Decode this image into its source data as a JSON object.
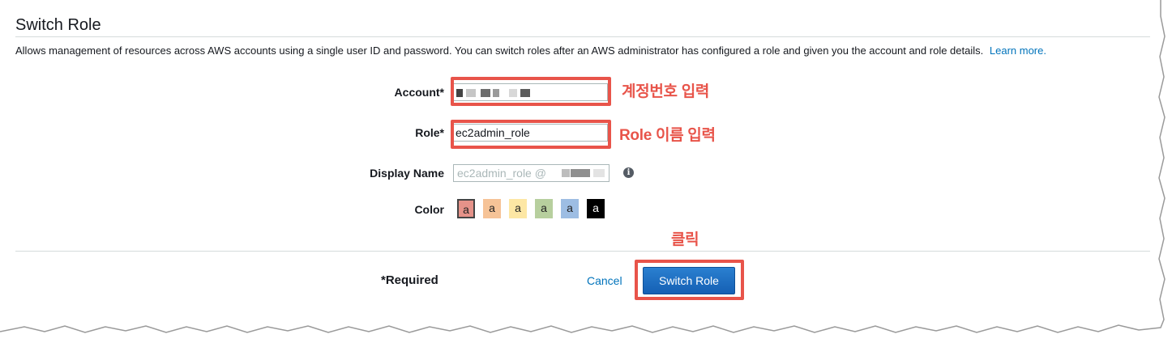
{
  "header": {
    "title": "Switch Role",
    "description": "Allows management of resources across AWS accounts using a single user ID and password. You can switch roles after an AWS administrator has configured a role and given you the account and role details.",
    "learn_more": "Learn more."
  },
  "form": {
    "account_label": "Account*",
    "account_value": "",
    "role_label": "Role*",
    "role_value": "ec2admin_role",
    "display_name_label": "Display Name",
    "display_name_placeholder": "ec2admin_role @",
    "color_label": "Color",
    "swatches": [
      {
        "letter": "a",
        "color": "#e59289",
        "selected": true
      },
      {
        "letter": "a",
        "color": "#f6c397"
      },
      {
        "letter": "a",
        "color": "#fde7a4"
      },
      {
        "letter": "a",
        "color": "#b7cf9e"
      },
      {
        "letter": "a",
        "color": "#9dbde3"
      },
      {
        "letter": "a",
        "color": "#000000"
      }
    ]
  },
  "footer": {
    "required_label": "*Required",
    "cancel_label": "Cancel",
    "switch_label": "Switch Role"
  },
  "annotations": {
    "account_note": "계정번호 입력",
    "role_note": "Role 이름 입력",
    "click_note": "클릭"
  },
  "colors": {
    "highlight": "#e8544a",
    "link": "#0073bb",
    "primary_button": "#1f6fc5"
  }
}
